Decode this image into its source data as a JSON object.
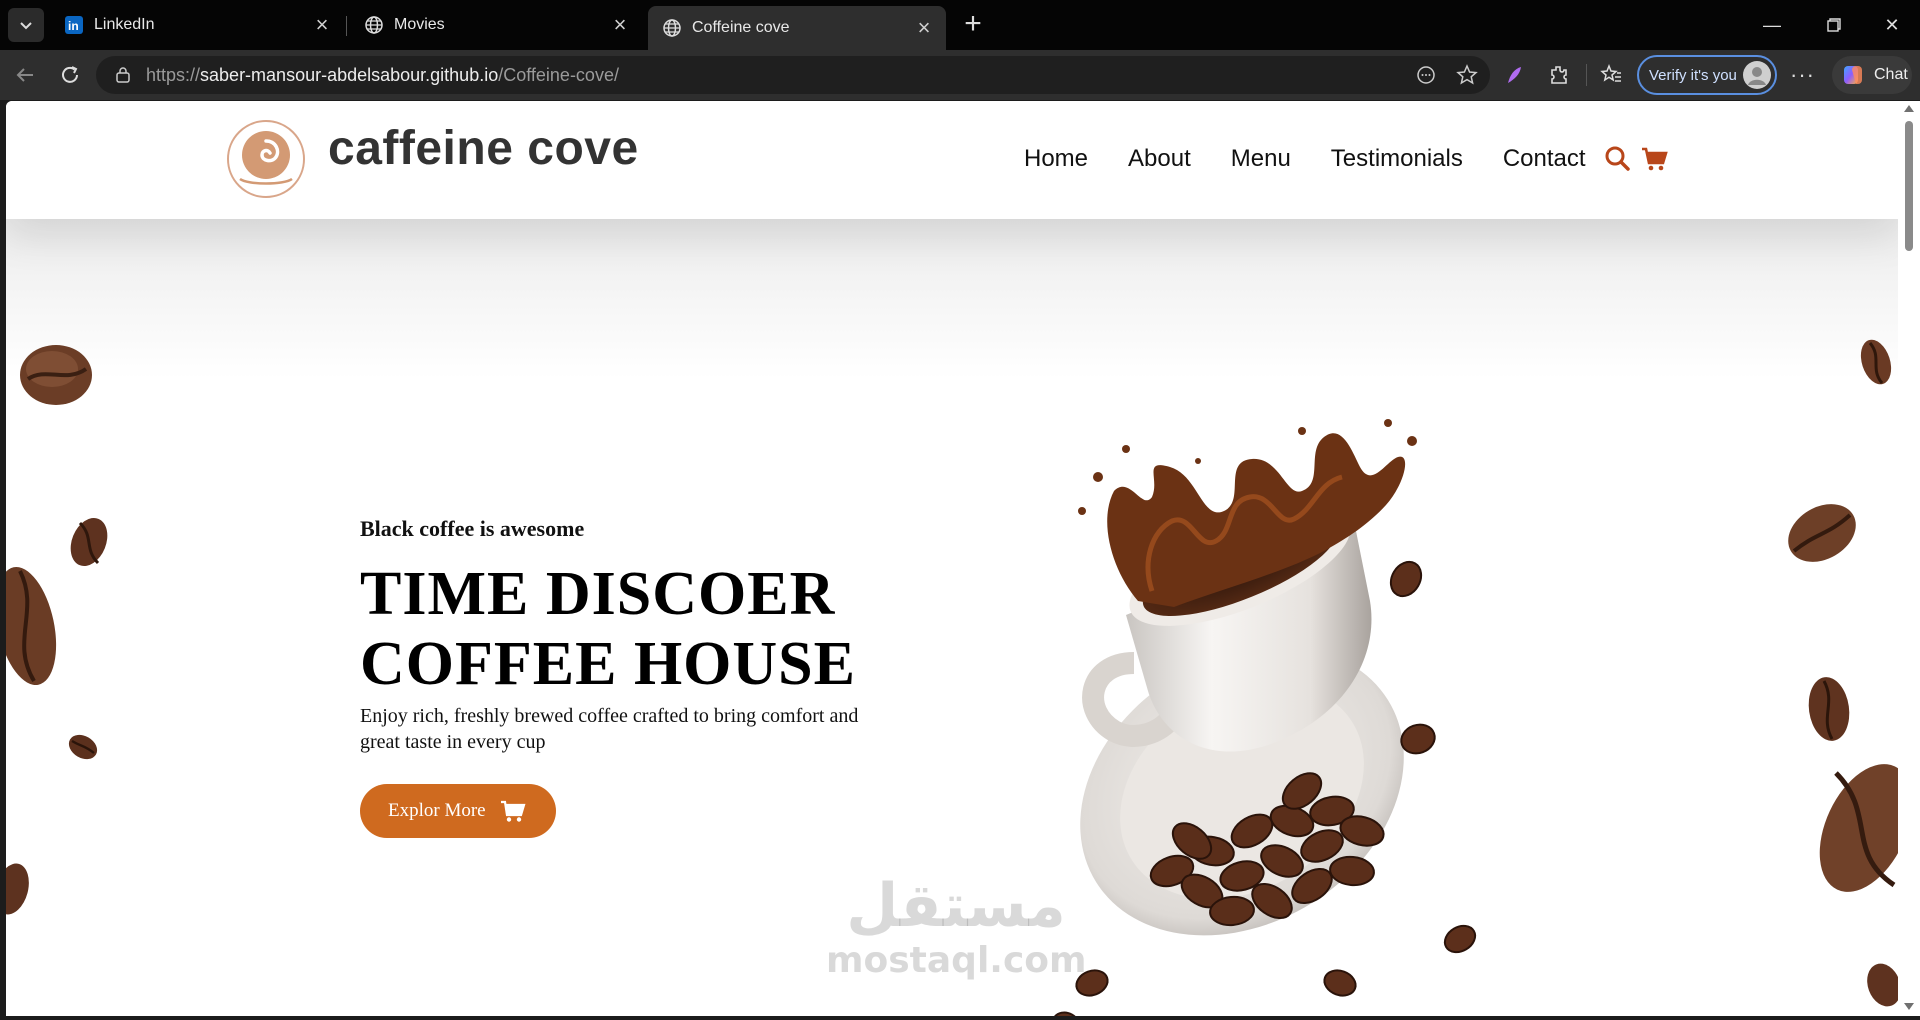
{
  "browser": {
    "tabs": [
      {
        "title": "LinkedIn",
        "icon": "linkedin-icon"
      },
      {
        "title": "Movies",
        "icon": "globe-icon"
      },
      {
        "title": "Coffeine cove",
        "icon": "globe-icon",
        "active": true
      }
    ],
    "url_scheme": "https://",
    "url_host": "saber-mansour-abdelsabour.github.io",
    "url_path": "/Coffeine-cove/",
    "verify_label": "Verify it's you",
    "chat_label": "Chat"
  },
  "site": {
    "brand": "caffeine cove",
    "accent_color": "#cf6a1f",
    "nav": [
      "Home",
      "About",
      "Menu",
      "Testimonials",
      "Contact"
    ]
  },
  "hero": {
    "kicker": "Black coffee is awesome",
    "headline_line1": "TIME DISCOER",
    "headline_line2": "COFFEE HOUSE",
    "description": "Enjoy rich, freshly brewed coffee crafted to bring comfort and great taste in every cup",
    "cta_label": "Explor More"
  },
  "watermark": {
    "arabic": "مستقل",
    "latin": "mostaql.com"
  }
}
